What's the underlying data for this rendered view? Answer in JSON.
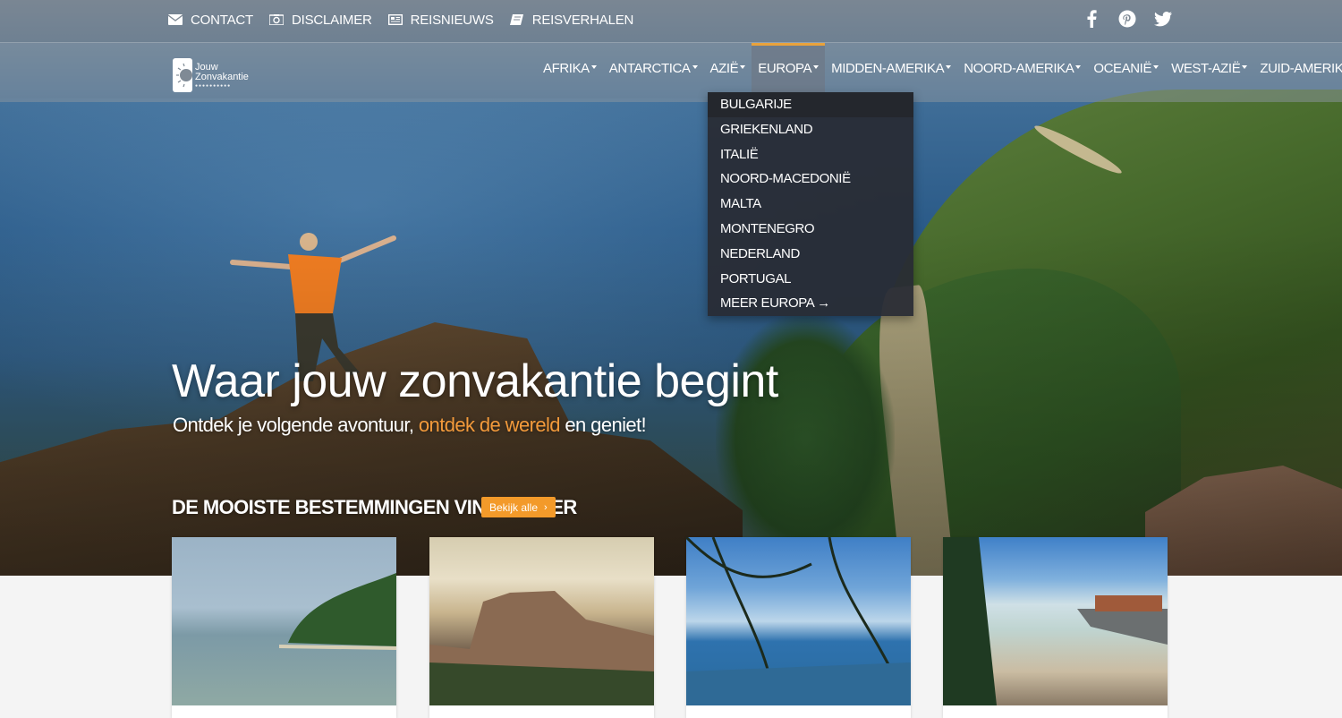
{
  "topbar": {
    "links": [
      {
        "label": "CONTACT",
        "icon": "envelope-icon"
      },
      {
        "label": "DISCLAIMER",
        "icon": "camera-icon"
      },
      {
        "label": "REISNIEUWS",
        "icon": "newspaper-icon"
      },
      {
        "label": "REISVERHALEN",
        "icon": "book-icon"
      }
    ],
    "social": [
      "facebook-icon",
      "pinterest-icon",
      "twitter-icon"
    ]
  },
  "logo": {
    "text": "Jouw Zonvakantie",
    "sub": "●●●●●●●●●●"
  },
  "nav": {
    "items": [
      "AFRIKA",
      "ANTARCTICA",
      "AZIË",
      "EUROPA",
      "MIDDEN-AMERIKA",
      "NOORD-AMERIKA",
      "OCEANIË",
      "WEST-AZIË",
      "ZUID-AMERIKA"
    ],
    "active": "EUROPA"
  },
  "dropdown": {
    "items": [
      "BULGARIJE",
      "GRIEKENLAND",
      "ITALIË",
      "NOORD-MACEDONIË",
      "MALTA",
      "MONTENEGRO",
      "NEDERLAND",
      "PORTUGAL",
      "MEER EUROPA →"
    ]
  },
  "hero": {
    "headline": "Waar jouw zonvakantie begint",
    "sub_before": "Ontdek je volgende avontuur, ",
    "sub_highlight": "ontdek de wereld",
    "sub_after": " en geniet!"
  },
  "destinations": {
    "title": "DE MOOISTE BESTEMMINGEN VIND JE HIER",
    "button": "Bekijk alle",
    "button_icon": "chevron-right-icon"
  },
  "colors": {
    "accent": "#f39a2a",
    "dropdown_bg": "#282c34"
  }
}
